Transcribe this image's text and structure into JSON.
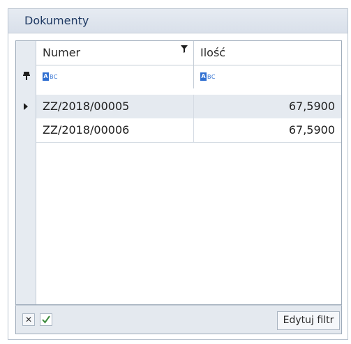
{
  "panel": {
    "title": "Dokumenty"
  },
  "grid": {
    "columns": [
      {
        "key": "numer",
        "label": "Numer",
        "filter_applied": true
      },
      {
        "key": "ilosc",
        "label": "Ilość",
        "filter_applied": false
      }
    ],
    "filter_row": {
      "numer_icon": "abc-text-filter-icon",
      "ilosc_icon": "abc-text-filter-icon",
      "icon_a": "A",
      "icon_bc": "BC"
    },
    "rows": [
      {
        "numer": "ZZ/2018/00005",
        "ilosc": "67,5900",
        "selected": true
      },
      {
        "numer": "ZZ/2018/00006",
        "ilosc": "67,5900",
        "selected": false
      }
    ]
  },
  "footer": {
    "clear_filter_icon": "close-x-icon",
    "filter_enabled": true,
    "edit_filter_label": "Edytuj filtr"
  },
  "colors": {
    "header_bg": "#dfe5ee",
    "selected_row": "#e5eaf0",
    "accent_blue": "#2f6fd1",
    "check_green": "#3a8a3a"
  }
}
